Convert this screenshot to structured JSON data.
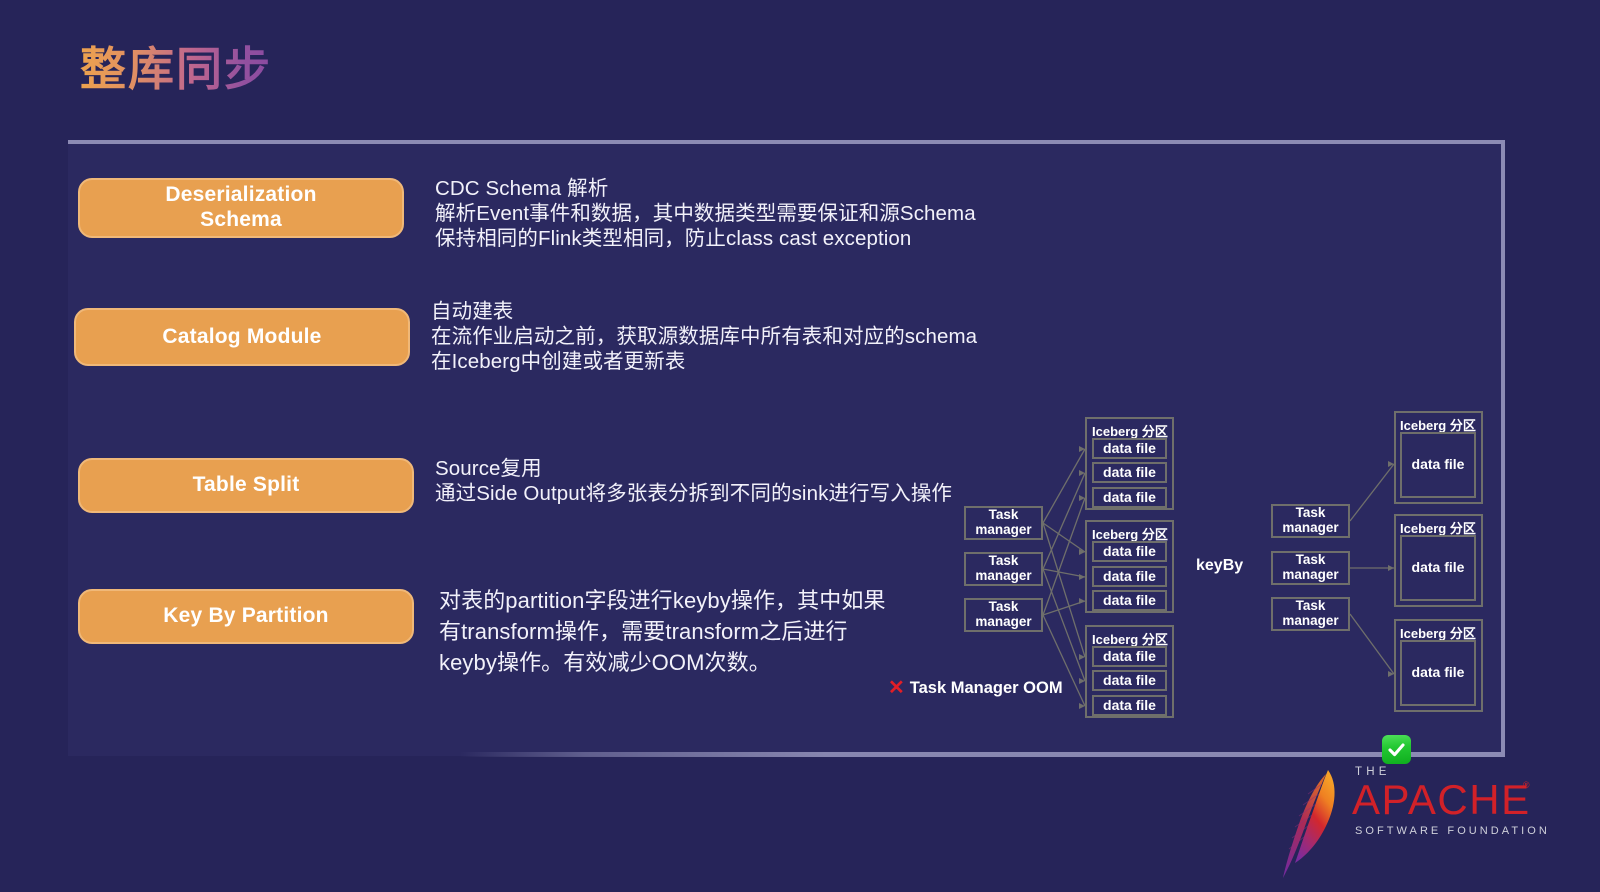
{
  "slide": {
    "title": "整库同步"
  },
  "features": [
    {
      "chip": "Deserialization\nSchema",
      "desc": "CDC Schema 解析\n解析Event事件和数据，其中数据类型需要保证和源Schema\n保持相同的Flink类型相同，防止class cast exception"
    },
    {
      "chip": "Catalog Module",
      "desc": "自动建表\n在流作业启动之前，获取源数据库中所有表和对应的schema\n在Iceberg中创建或者更新表"
    },
    {
      "chip": "Table Split",
      "desc": "Source复用\n通过Side Output将多张表分拆到不同的sink进行写入操作"
    },
    {
      "chip": "Key By Partition",
      "desc": "对表的partition字段进行keyby操作，其中如果\n有transform操作，需要transform之后进行\nkeyby操作。有效减少OOM次数。"
    }
  ],
  "diagram": {
    "task_manager_label": "Task\nmanager",
    "partition_label": "Iceberg 分区",
    "data_file_label": "data file",
    "keyby_label": "keyBy",
    "left": {
      "task_managers": [
        "Task\nmanager",
        "Task\nmanager",
        "Task\nmanager"
      ],
      "partitions": [
        {
          "title": "Iceberg 分区",
          "files": [
            "data file",
            "data file",
            "data file"
          ]
        },
        {
          "title": "Iceberg 分区",
          "files": [
            "data file",
            "data file",
            "data file"
          ]
        },
        {
          "title": "Iceberg 分区",
          "files": [
            "data file",
            "data file",
            "data file"
          ]
        }
      ]
    },
    "right": {
      "task_managers": [
        "Task\nmanager",
        "Task\nmanager",
        "Task\nmanager"
      ],
      "partitions": [
        {
          "title": "Iceberg 分区",
          "files": [
            "data file"
          ]
        },
        {
          "title": "Iceberg 分区",
          "files": [
            "data file"
          ]
        },
        {
          "title": "Iceberg 分区",
          "files": [
            "data file"
          ]
        }
      ]
    }
  },
  "annotations": {
    "oom_mark": "✕",
    "oom_text": "Task Manager OOM",
    "ok_mark": "✓"
  },
  "logo": {
    "the": "THE",
    "apache": "APACHE",
    "registered": "®",
    "foundation": "SOFTWARE FOUNDATION"
  },
  "colors": {
    "background": "#262459",
    "panel": "#2b2960",
    "panel_border": "#8c8bb4",
    "chip_fill": "#e8a050",
    "chip_border": "#f0b878",
    "wire": "#6f6f6b",
    "error_red": "#e21e26",
    "ok_green": "#23c832",
    "apache_red": "#d22128"
  }
}
